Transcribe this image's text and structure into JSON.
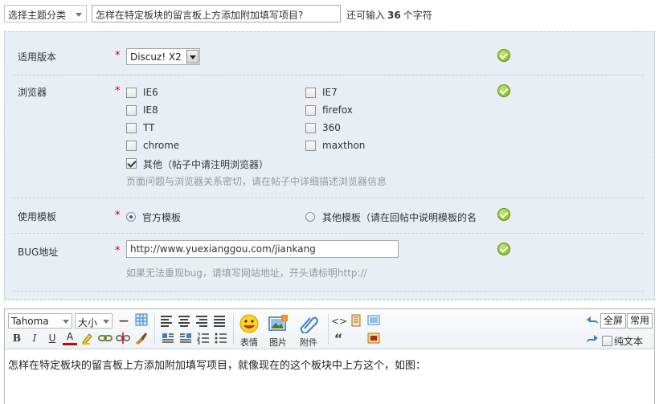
{
  "topic": {
    "category_select": "选择主题分类",
    "title_value": "怎样在特定板块的留言板上方添加附加填写项目?",
    "remain_prefix": "还可输入",
    "remain_count": "36",
    "remain_suffix": "个字符"
  },
  "form": {
    "version": {
      "label": "适用版本",
      "required": "*",
      "value": "Discuz! X2"
    },
    "browser": {
      "label": "浏览器",
      "required": "*",
      "options": [
        {
          "label": "IE6",
          "checked": false
        },
        {
          "label": "IE7",
          "checked": false
        },
        {
          "label": "IE8",
          "checked": false
        },
        {
          "label": "firefox",
          "checked": false
        },
        {
          "label": "TT",
          "checked": false
        },
        {
          "label": "360",
          "checked": false
        },
        {
          "label": "chrome",
          "checked": false
        },
        {
          "label": "maxthon",
          "checked": false
        },
        {
          "label": "其他（帖子中请注明浏览器）",
          "checked": true
        }
      ],
      "hint": "页面问题与浏览器关系密切，请在帖子中详细描述浏览器信息"
    },
    "template": {
      "label": "使用模板",
      "required": "*",
      "options": [
        {
          "label": "官方模板",
          "checked": true
        },
        {
          "label": "其他模板（请在回帖中说明模板的名",
          "checked": false
        }
      ]
    },
    "bug_url": {
      "label": "BUG地址",
      "required": "*",
      "value": "http://www.yuexianggou.com/jiankang",
      "hint": "如果无法重现bug，请填写网站地址，开头请标明http://"
    }
  },
  "editor": {
    "font_select": "Tahoma",
    "size_select": "大小",
    "buttons": {
      "emoticon": "表情",
      "image": "图片",
      "attachment": "附件",
      "fullscreen": "全屏",
      "common": "常用",
      "plaintext": "纯文本"
    },
    "format": {
      "bold": "B",
      "italic": "I",
      "underline": "U",
      "color": "A",
      "quote": "“"
    },
    "content": "怎样在特定板块的留言板上方添加附加填写项目，就像现在的这个板块中上方这个，如图："
  },
  "colors": {
    "panel_bg": "#e8eef4",
    "required": "#cc0000",
    "ok": "#7cb01c",
    "hint": "#999999"
  }
}
